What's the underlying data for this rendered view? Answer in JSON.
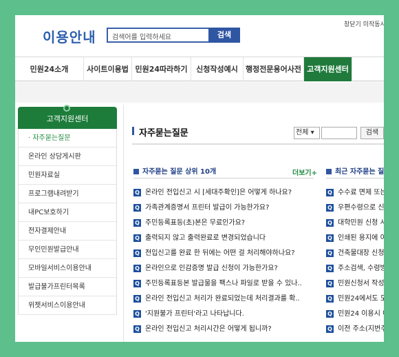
{
  "header": {
    "logo": "이용안내",
    "search_placeholder": "검색어를 입력하세요",
    "search_button": "검색",
    "top_links": "창닫기 미작동시 성"
  },
  "nav": {
    "items": [
      "민원24소개",
      "사이트이용법",
      "민원24따라하기",
      "신청작성예시",
      "행정전문용어사전",
      "고객지원센터"
    ],
    "active": "고객지원센터"
  },
  "sidebar": {
    "title": "고객지원센터",
    "items": [
      "자주묻는질문",
      "온라인 상담게시판",
      "민원자료실",
      "프로그램내려받기",
      "내PC보호하기",
      "전자결제안내",
      "무인민원발급안내",
      "모바일서비스이용안내",
      "발급불가프린터목록",
      "위젯서비스이용안내"
    ]
  },
  "main": {
    "title": "자주묻는질문",
    "filter_select": "전체",
    "filter_button": "검색",
    "left_list": {
      "heading": "자주묻는 질문 상위 10개",
      "more": "더보기+",
      "items": [
        "온라인 전입신고 시 [세대주확인]은 어떻게 하나요?",
        "가족관계증명서 프린터 발급이 가능한가요?",
        "주민등록표등(초)본은 무료인가요?",
        "출력되지 않고 출력완료로 변경되었습니다",
        "전입신고를 완료 한 뒤에는 어떤 걸 처리해야하나요?",
        "온라인으로 인감증명 발급 신청이 가능한가요?",
        "주민등록표등본 발급물을 팩스나 파일로 받을 수 있나..",
        "온라인 전입신고 처리가 완료되었는데 처리결과를 확..",
        "'지원불가 프린터'라고 나타납니다.",
        "온라인 전입신고 처리시간은 어떻게 됩니까?"
      ]
    },
    "right_list": {
      "heading": "최근 자주묻는 질문",
      "items": [
        "수수료 면제 또는",
        "우편수령으로 신",
        "대학민원 신청 시",
        "인쇄된 용지에 이",
        "건축물대장 신청",
        "주소검색, 수령방",
        "민원신청서 작성",
        "민원24에서도 도",
        "민원24 이용시 어",
        "이전 주소(지번주"
      ]
    }
  }
}
